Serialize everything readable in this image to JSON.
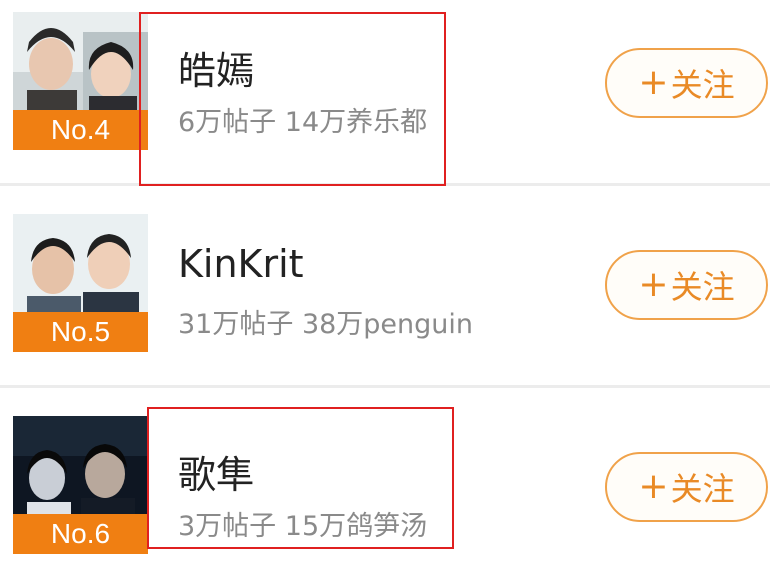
{
  "items": [
    {
      "rank": "No.4",
      "title": "皓嫣",
      "meta": "6万帖子 14万养乐都",
      "follow_plus": "+",
      "follow_label": "关注",
      "thumb_icon": "photo-couple-icon"
    },
    {
      "rank": "No.5",
      "title": "KinKrit",
      "meta": "31万帖子 38万penguin",
      "follow_plus": "+",
      "follow_label": "关注",
      "thumb_icon": "photo-two-men-icon"
    },
    {
      "rank": "No.6",
      "title": "歌隼",
      "meta": "3万帖子 15万鸽笋汤",
      "follow_plus": "+",
      "follow_label": "关注",
      "thumb_icon": "photo-night-couple-icon"
    }
  ],
  "colors": {
    "rank_badge": "#f07f12",
    "follow_border": "#f0a24a",
    "follow_text": "#e98a26",
    "highlight_box": "#e02020"
  }
}
